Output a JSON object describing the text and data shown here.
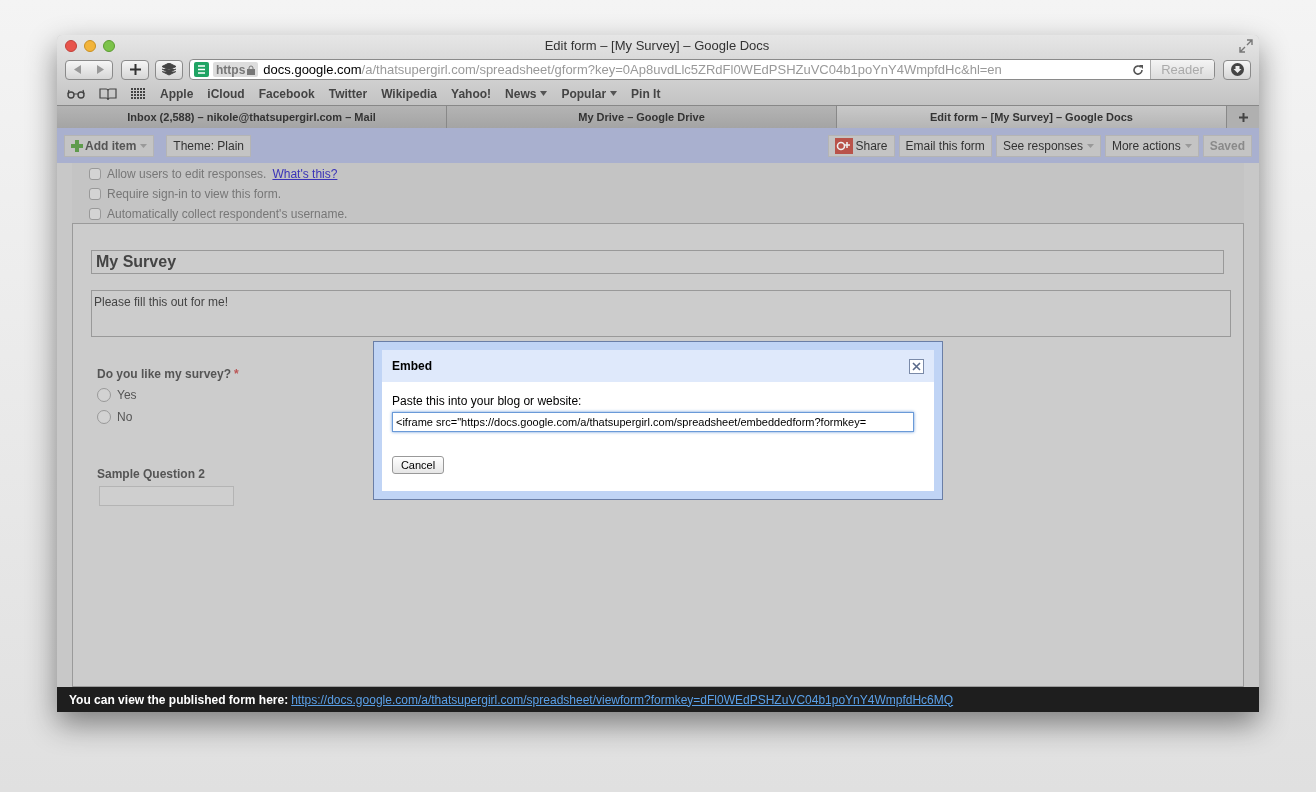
{
  "window": {
    "title": "Edit form – [My Survey] – Google Docs"
  },
  "address_bar": {
    "scheme": "https",
    "host": "docs.google.com",
    "path": "/a/thatsupergirl.com/spreadsheet/gform?key=0Ap8uvdLlc5ZRdFl0WEdPSHZuVC04b1poYnY4WmpfdHc&hl=en",
    "reader": "Reader"
  },
  "bookmarks": [
    {
      "label": "Apple",
      "menu": false
    },
    {
      "label": "iCloud",
      "menu": false
    },
    {
      "label": "Facebook",
      "menu": false
    },
    {
      "label": "Twitter",
      "menu": false
    },
    {
      "label": "Wikipedia",
      "menu": false
    },
    {
      "label": "Yahoo!",
      "menu": false
    },
    {
      "label": "News",
      "menu": true
    },
    {
      "label": "Popular",
      "menu": true
    },
    {
      "label": "Pin It",
      "menu": false
    }
  ],
  "tabs": [
    {
      "label": "Inbox (2,588) – nikole@thatsupergirl.com – Mail",
      "selected": false
    },
    {
      "label": "My Drive – Google Drive",
      "selected": false
    },
    {
      "label": "Edit form – [My Survey] – Google Docs",
      "selected": true
    }
  ],
  "toolbar": {
    "left": [
      {
        "label": "Add item",
        "kind": "add",
        "menu": true
      },
      {
        "label": "Theme:  Plain",
        "kind": "plain",
        "menu": false
      }
    ],
    "right": [
      {
        "label": "Share",
        "kind": "share",
        "menu": false,
        "disabled": false
      },
      {
        "label": "Email this form",
        "kind": "plain",
        "menu": false,
        "disabled": false
      },
      {
        "label": "See responses",
        "kind": "plain",
        "menu": true,
        "disabled": false
      },
      {
        "label": "More actions",
        "kind": "plain",
        "menu": true,
        "disabled": false
      },
      {
        "label": "Saved",
        "kind": "plain",
        "menu": false,
        "disabled": true
      }
    ]
  },
  "settings": [
    {
      "label": "Allow users to edit responses.",
      "link": "What's this?",
      "checked": false
    },
    {
      "label": "Require sign-in to view this form.",
      "checked": false
    },
    {
      "label": "Automatically collect respondent's username.",
      "checked": false
    }
  ],
  "form": {
    "title": "My Survey",
    "description": "Please fill this out for me!",
    "questions": [
      {
        "kind": "radio",
        "title": "Do you like my survey?",
        "required_mark": "*",
        "options": [
          {
            "label": "Yes",
            "selected": false
          },
          {
            "label": "No",
            "selected": false
          }
        ]
      },
      {
        "kind": "text",
        "title": "Sample Question 2"
      }
    ]
  },
  "dialog": {
    "title": "Embed",
    "prompt": "Paste this into your blog or website:",
    "value": "<iframe src=\"https://docs.google.com/a/thatsupergirl.com/spreadsheet/embeddedform?formkey=",
    "button": "Cancel"
  },
  "status_bar": {
    "text": "You can view the published form here:",
    "link": "https://docs.google.com/a/thatsupergirl.com/spreadsheet/viewform?formkey=dFl0WEdPSHZuVC04b1poYnY4WmpfdHc6MQ"
  }
}
